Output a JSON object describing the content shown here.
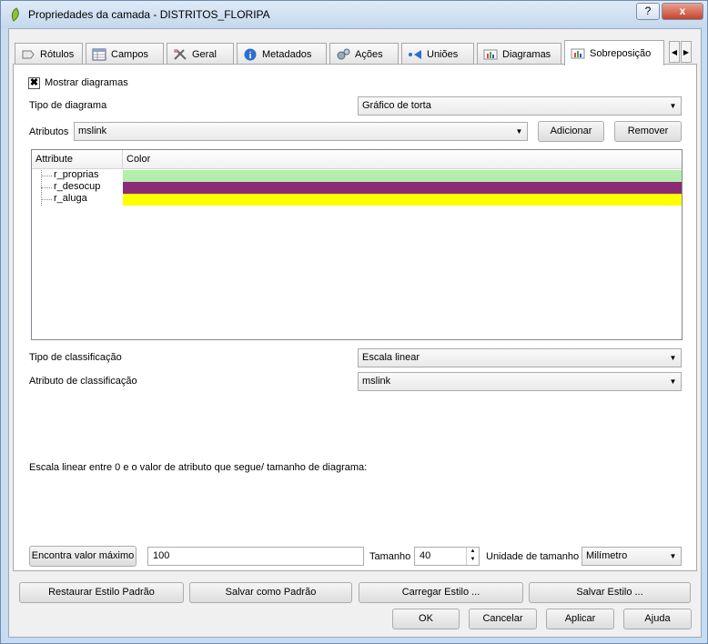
{
  "window": {
    "title": "Propriedades da camada - DISTRITOS_FLORIPA",
    "help_label": "?",
    "close_label": "x"
  },
  "tabs": [
    {
      "label": "Rótulos",
      "icon": "labels-icon"
    },
    {
      "label": "Campos",
      "icon": "table-icon"
    },
    {
      "label": "Geral",
      "icon": "tools-icon"
    },
    {
      "label": "Metadados",
      "icon": "info-icon"
    },
    {
      "label": "Ações",
      "icon": "gears-icon"
    },
    {
      "label": "Uniões",
      "icon": "join-icon"
    },
    {
      "label": "Diagramas",
      "icon": "diagram-icon"
    },
    {
      "label": "Sobreposição",
      "icon": "overlay-icon",
      "active": true
    }
  ],
  "overlay": {
    "show_diagrams_label": "Mostrar diagramas",
    "show_diagrams_checked": true,
    "diagram_type_label": "Tipo de diagrama",
    "diagram_type_value": "Gráfico de torta",
    "attributes_label": "Atributos",
    "attributes_value": "mslink",
    "add_label": "Adicionar",
    "remove_label": "Remover",
    "tree_headers": [
      "Attribute",
      "Color"
    ],
    "tree_rows": [
      {
        "name": "r_proprias",
        "color": "#b3eeac"
      },
      {
        "name": "r_desocup",
        "color": "#8c2a74"
      },
      {
        "name": "r_aluga",
        "color": "#ffff00"
      }
    ],
    "classification_type_label": "Tipo de classificação",
    "classification_type_value": "Escala linear",
    "classification_attr_label": "Atributo de classificação",
    "classification_attr_value": "mslink",
    "scale_text": "Escala linear entre 0 e o valor de atributo que segue/ tamanho de diagrama:",
    "find_max_label": "Encontra valor máximo",
    "max_value": "100",
    "size_label": "Tamanho",
    "size_value": "40",
    "size_unit_label": "Unidade de tamanho",
    "size_unit_value": "Milímetro"
  },
  "footer": {
    "restore_label": "Restaurar Estilo Padrão",
    "save_default_label": "Salvar como Padrão",
    "load_style_label": "Carregar Estilo ...",
    "save_style_label": "Salvar Estilo ...",
    "ok_label": "OK",
    "cancel_label": "Cancelar",
    "apply_label": "Aplicar",
    "help_label": "Ajuda"
  }
}
